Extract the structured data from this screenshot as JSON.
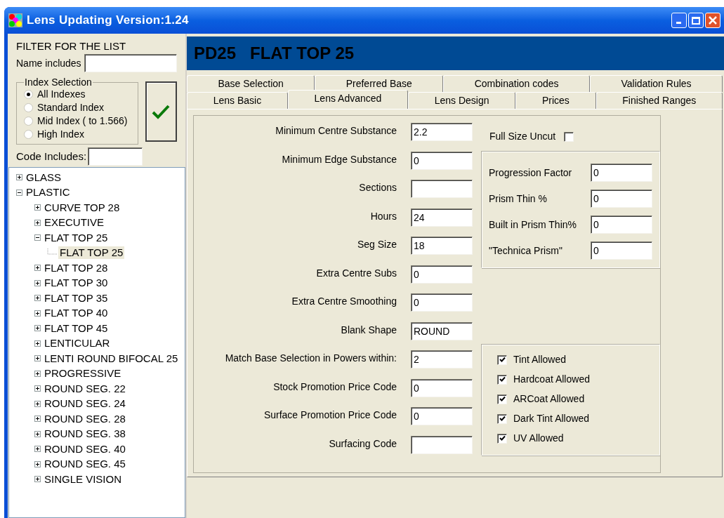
{
  "window": {
    "title": "Lens Updating  Version:1.24"
  },
  "filter": {
    "heading": "FILTER FOR THE LIST",
    "name_label": "Name includes",
    "code_label": "Code Includes:"
  },
  "index_selection": {
    "legend": "Index Selection",
    "options": [
      {
        "label": "All Indexes",
        "selected": true
      },
      {
        "label": "Standard Index",
        "selected": false
      },
      {
        "label": "Mid Index ( to 1.566)",
        "selected": false
      },
      {
        "label": "High Index",
        "selected": false
      }
    ]
  },
  "tree": [
    {
      "label": "GLASS",
      "expanded": false,
      "selected": false
    },
    {
      "label": "PLASTIC",
      "expanded": true,
      "selected": false,
      "children": [
        {
          "label": "CURVE TOP 28",
          "expanded": false,
          "selected": false
        },
        {
          "label": "EXECUTIVE",
          "expanded": false,
          "selected": false
        },
        {
          "label": "FLAT TOP 25",
          "expanded": true,
          "selected": false,
          "children": [
            {
              "label": "FLAT TOP 25",
              "selected": true
            }
          ]
        },
        {
          "label": "FLAT TOP 28",
          "expanded": false,
          "selected": false
        },
        {
          "label": "FLAT TOP 30",
          "expanded": false,
          "selected": false
        },
        {
          "label": "FLAT TOP 35",
          "expanded": false,
          "selected": false
        },
        {
          "label": "FLAT TOP 40",
          "expanded": false,
          "selected": false
        },
        {
          "label": "FLAT TOP 45",
          "expanded": false,
          "selected": false
        },
        {
          "label": "LENTICULAR",
          "expanded": false,
          "selected": false
        },
        {
          "label": "LENTI ROUND BIFOCAL 25",
          "expanded": false,
          "selected": false
        },
        {
          "label": "PROGRESSIVE",
          "expanded": false,
          "selected": false
        },
        {
          "label": "ROUND SEG. 22",
          "expanded": false,
          "selected": false
        },
        {
          "label": "ROUND SEG. 24",
          "expanded": false,
          "selected": false
        },
        {
          "label": "ROUND SEG. 28",
          "expanded": false,
          "selected": false
        },
        {
          "label": "ROUND SEG. 38",
          "expanded": false,
          "selected": false
        },
        {
          "label": "ROUND SEG. 40",
          "expanded": false,
          "selected": false
        },
        {
          "label": "ROUND SEG. 45",
          "expanded": false,
          "selected": false
        },
        {
          "label": "SINGLE VISION",
          "expanded": false,
          "selected": false
        }
      ]
    }
  ],
  "header_title": "PD25   FLAT TOP 25",
  "tab_rows": [
    [
      {
        "label": "Base Selection",
        "selected": false
      },
      {
        "label": "Preferred Base",
        "selected": false
      },
      {
        "label": "Combination codes",
        "selected": false
      },
      {
        "label": "Validation Rules",
        "selected": false
      }
    ],
    [
      {
        "label": "Lens Basic",
        "selected": false
      },
      {
        "label": "Lens Advanced",
        "selected": true
      },
      {
        "label": "Lens Design",
        "selected": false
      },
      {
        "label": "Prices",
        "selected": false
      },
      {
        "label": "Finished Ranges",
        "selected": false
      }
    ]
  ],
  "fields": [
    {
      "label": "Minimum Centre Substance",
      "value": "2.2"
    },
    {
      "label": "Minimum Edge Substance",
      "value": "0"
    },
    {
      "label": "Sections"
    },
    {
      "label": "Hours",
      "value": "24"
    },
    {
      "label": "Seg Size",
      "value": "18"
    },
    {
      "label": "Extra Centre Subs",
      "value": "0"
    },
    {
      "label": "Extra Centre Smoothing",
      "value": "0"
    },
    {
      "label": "Blank Shape",
      "value": "ROUND"
    },
    {
      "label": "Match  Base Selection in Powers within:",
      "value": "2"
    },
    {
      "label": "Stock Promotion Price Code",
      "value": "0"
    },
    {
      "label": "Surface Promotion Price Code",
      "value": "0"
    },
    {
      "label": "Surfacing Code"
    }
  ],
  "full_size_uncut": {
    "label": "Full Size Uncut",
    "checked": false
  },
  "prism_fields": [
    {
      "label": "Progression Factor",
      "value": "0"
    },
    {
      "label": "Prism Thin %",
      "value": "0"
    },
    {
      "label": "Built in Prism Thin%",
      "value": "0"
    },
    {
      "label": "\"Technica Prism\"",
      "value": "0"
    }
  ],
  "allowances": [
    {
      "label": "Tint Allowed",
      "checked": true
    },
    {
      "label": "Hardcoat Allowed",
      "checked": true
    },
    {
      "label": "ARCoat Allowed",
      "checked": true
    },
    {
      "label": "Dark Tint Allowed",
      "checked": true
    },
    {
      "label": "UV Allowed",
      "checked": true
    }
  ]
}
